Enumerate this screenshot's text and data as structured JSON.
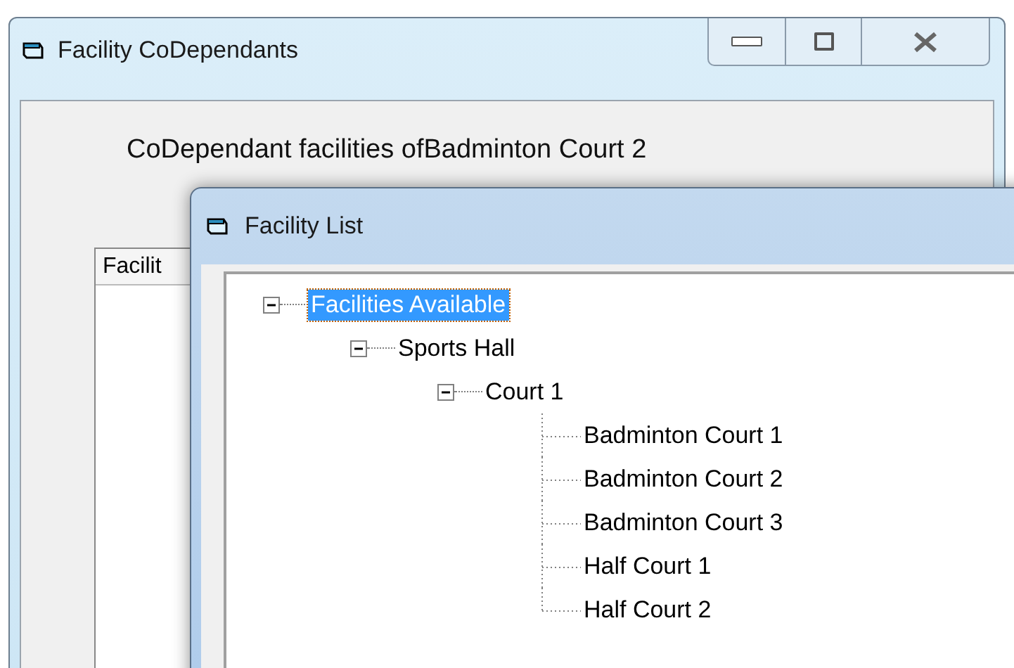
{
  "back_window": {
    "title": "Facility CoDependants",
    "heading": "CoDependant facilities ofBadminton Court 2",
    "list": {
      "column_1": "Facilit"
    }
  },
  "front_window": {
    "title": "Facility List",
    "tree": [
      {
        "label": "Facilities Available",
        "selected": true,
        "expanded": true,
        "children": [
          {
            "label": "Sports Hall",
            "selected": false,
            "expanded": true,
            "children": [
              {
                "label": "Court 1",
                "selected": false,
                "expanded": true,
                "children": [
                  {
                    "label": "Badminton Court 1",
                    "selected": false
                  },
                  {
                    "label": "Badminton Court 2",
                    "selected": false
                  },
                  {
                    "label": "Badminton Court 3",
                    "selected": false
                  },
                  {
                    "label": "Half Court 1",
                    "selected": false
                  },
                  {
                    "label": "Half Court 2",
                    "selected": false
                  }
                ]
              }
            ]
          }
        ]
      }
    ]
  }
}
